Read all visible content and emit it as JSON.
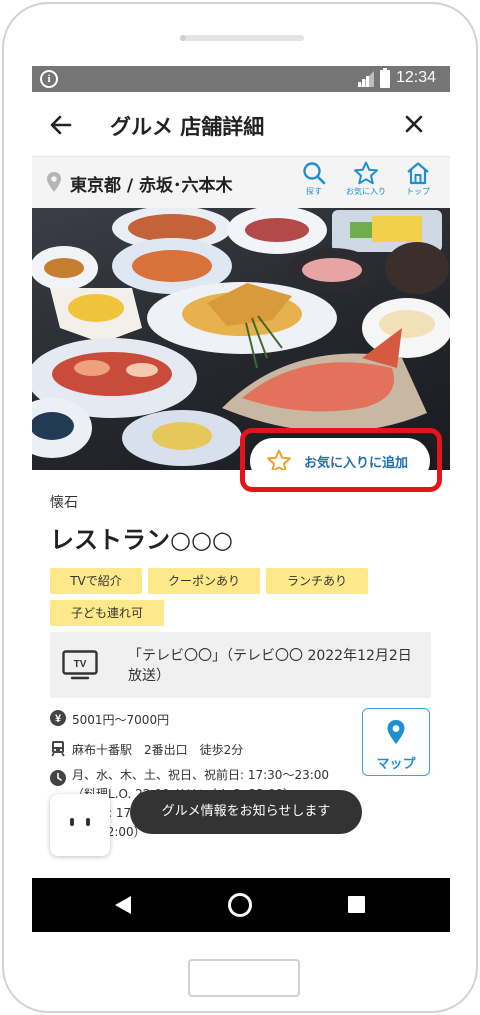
{
  "status_bar": {
    "time": "12:34",
    "info_icon": "info-icon",
    "signal_icon": "signal-icon",
    "battery_icon": "battery-icon"
  },
  "header": {
    "title": "グルメ 店舗詳細",
    "back_icon": "arrow-left-icon",
    "close_icon": "close-icon"
  },
  "location": {
    "text": "東京都 / 赤坂･六本木",
    "nav": [
      {
        "label": "探す",
        "icon": "search-icon"
      },
      {
        "label": "お気に入り",
        "icon": "star-icon"
      },
      {
        "label": "トップ",
        "icon": "home-icon"
      }
    ]
  },
  "hero": {
    "favorite_button_label": "お気に入りに追加",
    "highlight_color": "#e4141b"
  },
  "shop": {
    "category": "懐石",
    "name": "レストラン○○○",
    "tags": [
      "TVで紹介",
      "クーポンあり",
      "ランチあり",
      "子ども連れ可"
    ],
    "tv_notice": "「テレビ〇〇」（テレビ〇〇 2022年12月2日放送）",
    "budget": "5001円〜7000円",
    "access": "麻布十番駅　2番出口　徒歩2分",
    "hours_line1": "月、水、木、土、祝日、祝前日: 17:30〜23:00",
    "hours_line2": "（料理L.O. 22:00 ドリンクL.O. 22:00）",
    "hours_line3": "火、金: 17:30〜22:30 （料理L.O. 22:00 ドリンク",
    "hours_line4": "L.O. 22:00）"
  },
  "map_button": {
    "label": "マップ"
  },
  "toast": {
    "text": "グルメ情報をお知らせします"
  },
  "colors": {
    "accent": "#1f8fd0",
    "tag_bg": "#fde98a",
    "status_bar": "#757575",
    "star": "#f0a030"
  }
}
